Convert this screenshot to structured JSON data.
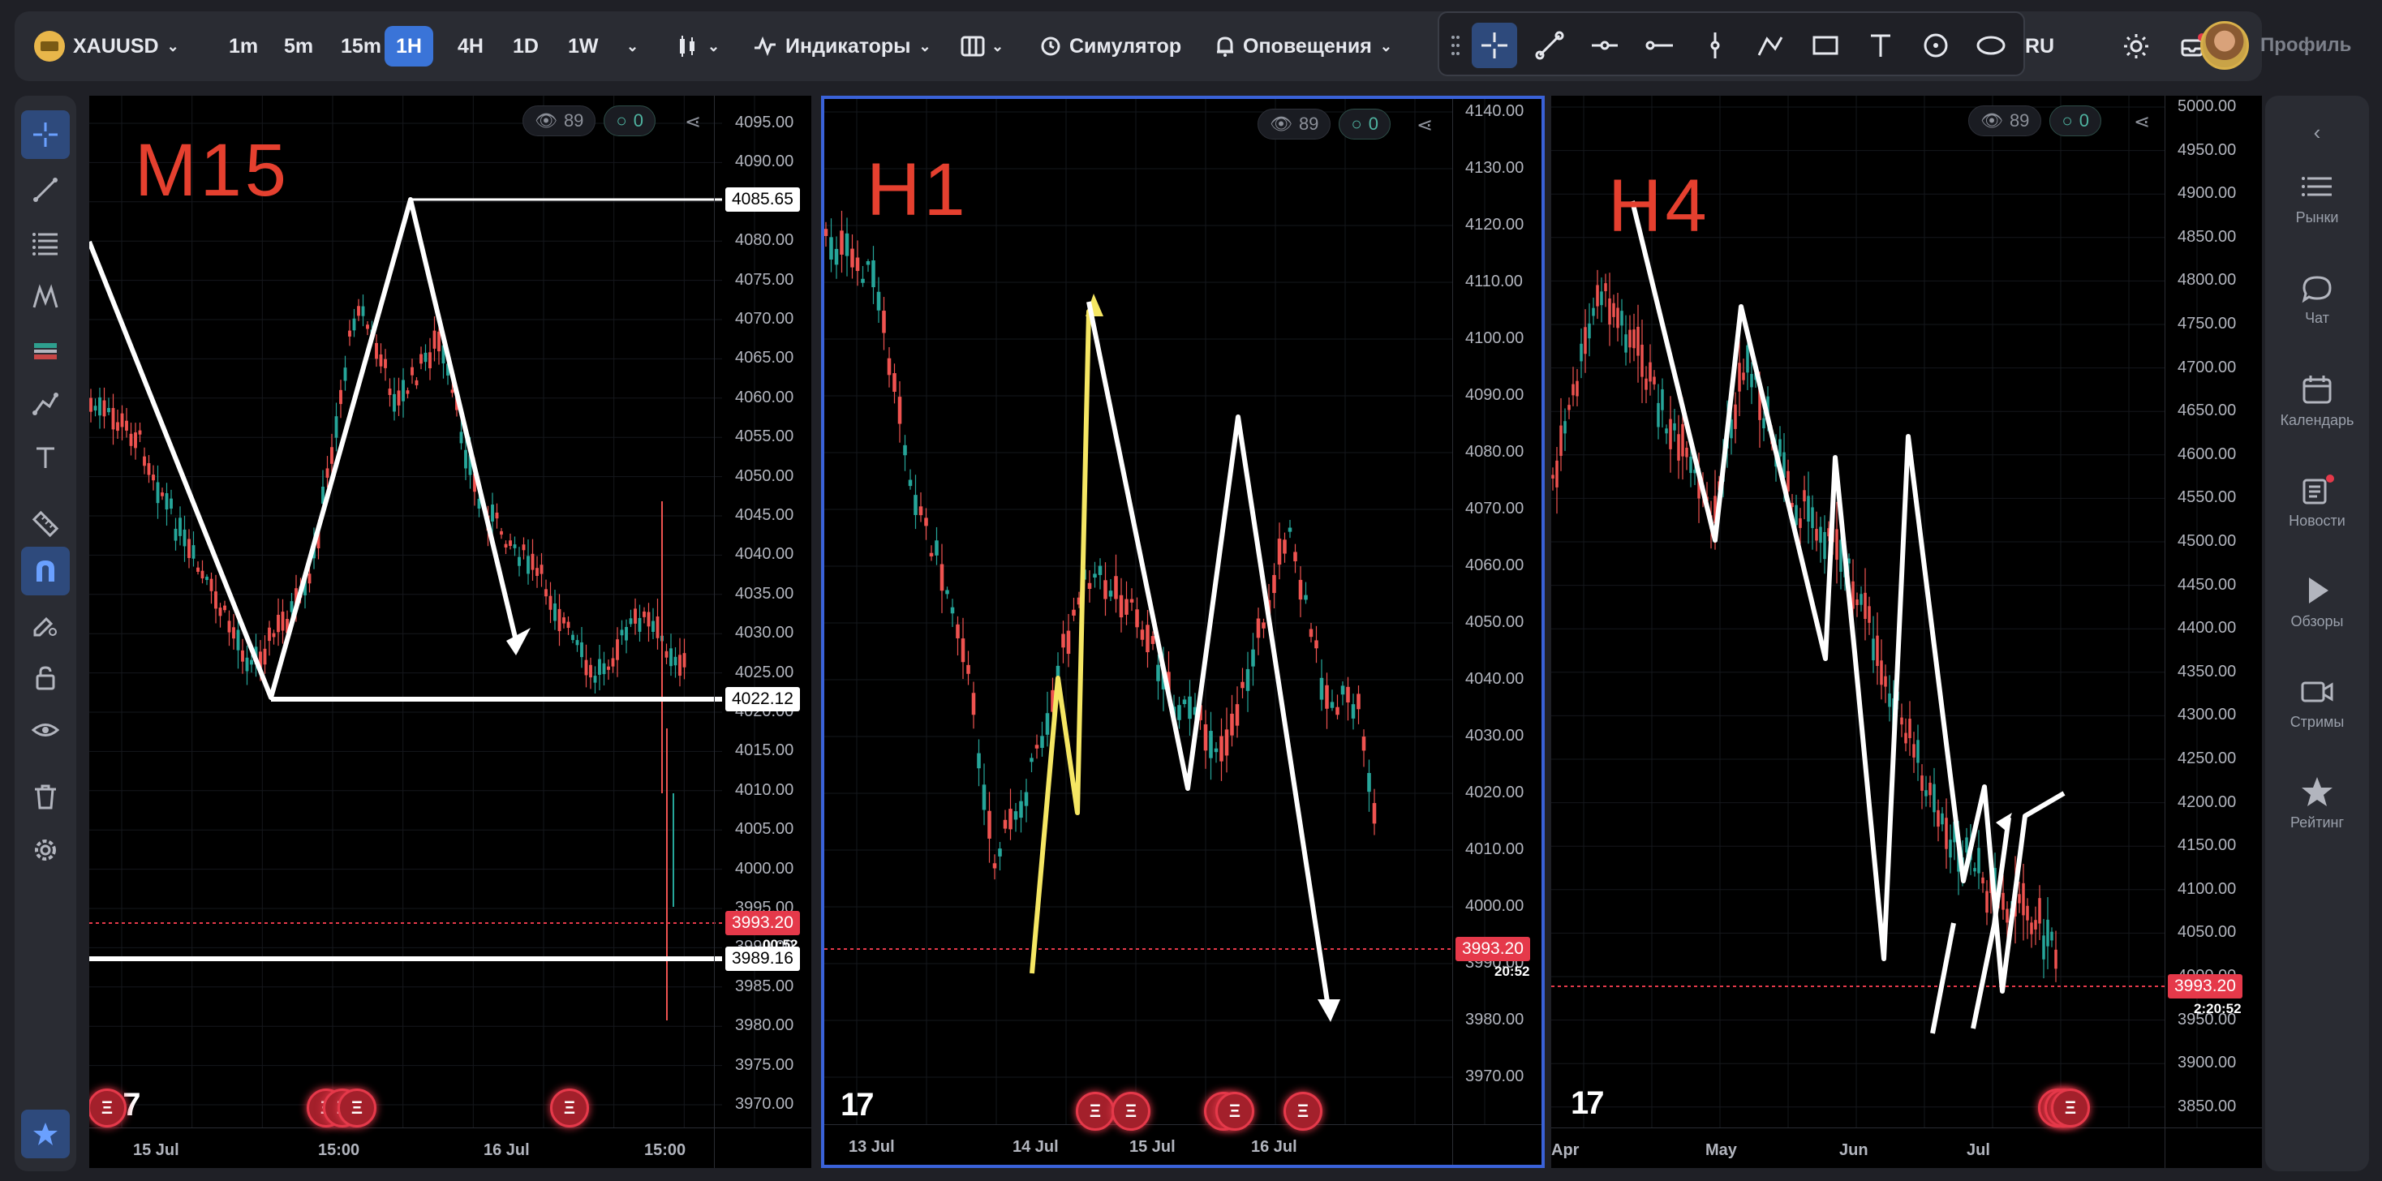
{
  "topbar": {
    "symbol": "XAUUSD",
    "timeframes": [
      "1m",
      "5m",
      "15m",
      "1H",
      "4H",
      "1D",
      "1W"
    ],
    "active_timeframe": "1H",
    "indicators_label": "Индикаторы",
    "simulator_label": "Симулятор",
    "alerts_label": "Оповещения",
    "lang_label": "RU",
    "profile_label": "Профиль"
  },
  "right_sidebar": [
    {
      "label": "Рынки",
      "icon": "list-icon"
    },
    {
      "label": "Чат",
      "icon": "chat-icon"
    },
    {
      "label": "Календарь",
      "icon": "calendar-icon"
    },
    {
      "label": "Новости",
      "icon": "news-icon"
    },
    {
      "label": "Обзоры",
      "icon": "play-icon"
    },
    {
      "label": "Стримы",
      "icon": "camera-icon"
    },
    {
      "label": "Рейтинг",
      "icon": "star-icon"
    }
  ],
  "panels": [
    {
      "id": "m15",
      "annotation": "M15",
      "views": "89",
      "ideas": "0",
      "y_ticks": [
        "4095.00",
        "4090.00",
        "4085.00",
        "4080.00",
        "4075.00",
        "4070.00",
        "4065.00",
        "4060.00",
        "4055.00",
        "4050.00",
        "4045.00",
        "4040.00",
        "4035.00",
        "4030.00",
        "4025.00",
        "4020.00",
        "4015.00",
        "4010.00",
        "4005.00",
        "4000.00",
        "3995.00",
        "3990.00",
        "3985.00",
        "3980.00",
        "3975.00",
        "3970.00"
      ],
      "x_ticks": [
        "15 Jul",
        "15:00",
        "16 Jul",
        "15:00"
      ],
      "level_tags": [
        "4085.65",
        "4022.12",
        "3989.16"
      ],
      "price_tag": "3993.20",
      "timer": "00:52"
    },
    {
      "id": "h1",
      "annotation": "H1",
      "views": "89",
      "ideas": "0",
      "y_ticks": [
        "4140.00",
        "4130.00",
        "4120.00",
        "4110.00",
        "4100.00",
        "4090.00",
        "4080.00",
        "4070.00",
        "4060.00",
        "4050.00",
        "4040.00",
        "4030.00",
        "4020.00",
        "4010.00",
        "4000.00",
        "3990.00",
        "3980.00",
        "3970.00"
      ],
      "x_ticks": [
        "13 Jul",
        "14 Jul",
        "15 Jul",
        "16 Jul"
      ],
      "price_tag": "3993.20",
      "timer": "20:52"
    },
    {
      "id": "h4",
      "annotation": "H4",
      "views": "89",
      "ideas": "0",
      "y_ticks": [
        "5000.00",
        "4950.00",
        "4900.00",
        "4850.00",
        "4800.00",
        "4750.00",
        "4700.00",
        "4650.00",
        "4600.00",
        "4550.00",
        "4500.00",
        "4450.00",
        "4400.00",
        "4350.00",
        "4300.00",
        "4250.00",
        "4200.00",
        "4150.00",
        "4100.00",
        "4050.00",
        "4000.00",
        "3950.00",
        "3900.00",
        "3850.00"
      ],
      "x_ticks": [
        "Apr",
        "May",
        "Jun",
        "Jul"
      ],
      "price_tag": "3993.20",
      "timer": "2:20:52"
    }
  ],
  "colors": {
    "up": "#26a69a",
    "down": "#ef5350",
    "accent": "#3a74d8",
    "annotation": "#e5402f",
    "yellow": "#f5e663"
  }
}
